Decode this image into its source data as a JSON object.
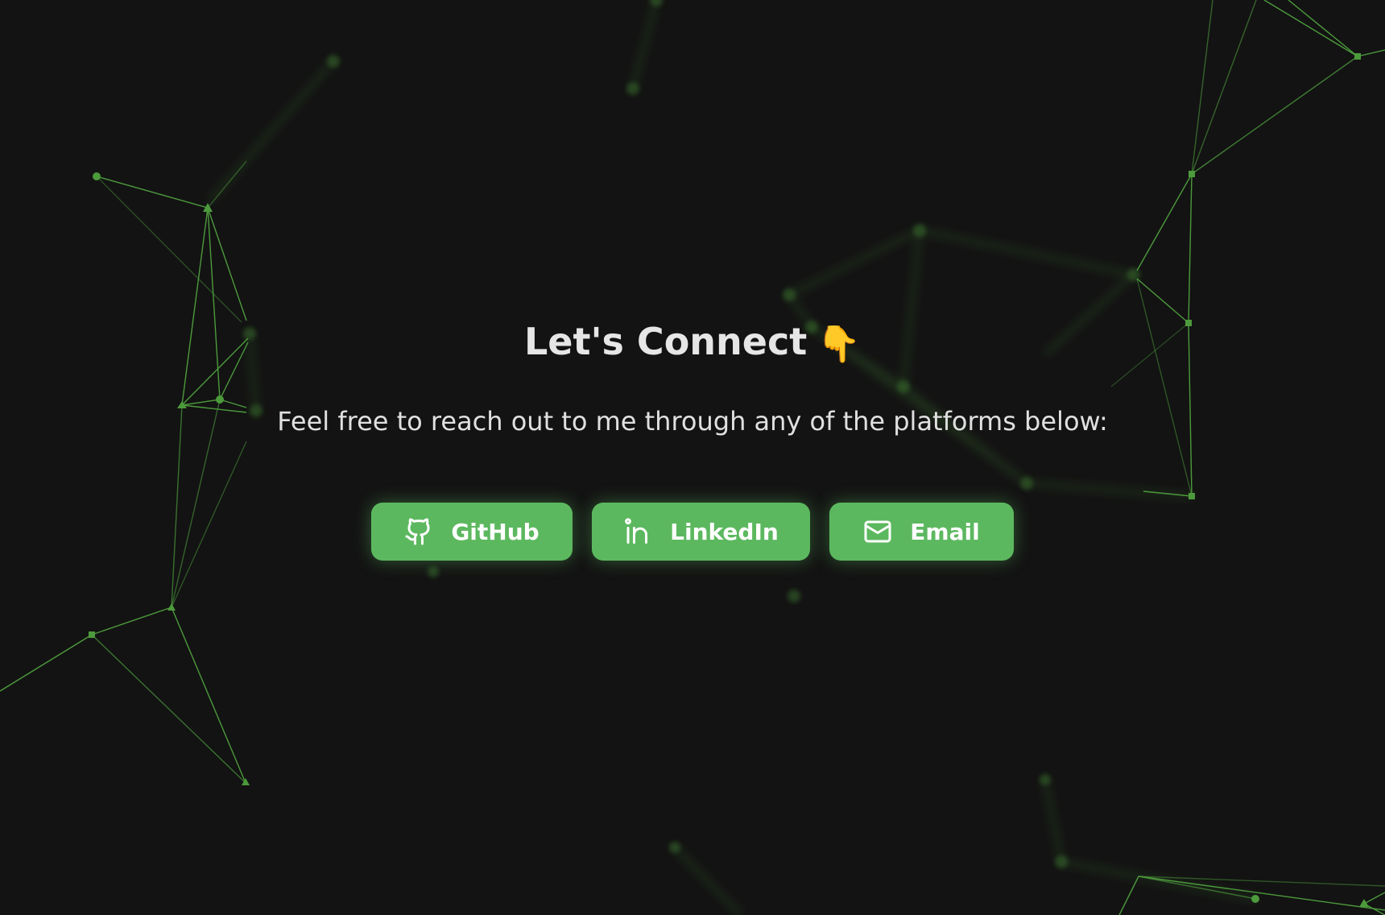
{
  "hero": {
    "title": "Let's Connect",
    "title_emoji": "👇",
    "subtitle": "Feel free to reach out to me through any of the platforms below:"
  },
  "links": [
    {
      "label": "GitHub",
      "icon": "github-icon"
    },
    {
      "label": "LinkedIn",
      "icon": "linkedin-icon"
    },
    {
      "label": "Email",
      "icon": "mail-icon"
    }
  ],
  "colors": {
    "background": "#131313",
    "accent": "#5cb85f",
    "network": "#4c9a3c",
    "text": "#e6e6e6"
  }
}
